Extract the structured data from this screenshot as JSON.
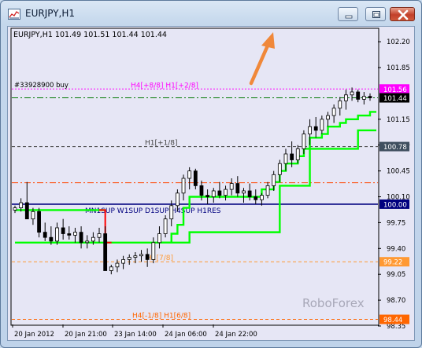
{
  "window": {
    "title": "EURJPY,H1",
    "icon": "chart-icon",
    "controls": [
      "minimize-icon",
      "maximize-icon",
      "close-icon"
    ]
  },
  "chart_info": {
    "symbol_line": "EURJPY,H1  101.49 101.51 101.44 101.44",
    "order_label": "#33928900 buy",
    "watermark": "RoboForex"
  },
  "colors": {
    "background": "#e6e6f5",
    "axis_text": "#000000",
    "candles": "#000000",
    "support_lines": "#00ff00",
    "resistance_line": "#ff0000",
    "level_line": "#00007f",
    "arrow": "#f0883a",
    "magenta": "#ff00ff",
    "orange": "#ff9933",
    "gray_dashed": "#444444",
    "dashdot_orange": "#ff6600"
  },
  "chart_data": {
    "type": "candlestick",
    "title": "EURJPY,H1",
    "y_range": [
      98.35,
      102.35
    ],
    "y_ticks": [
      "102.20",
      "101.85",
      "101.15",
      "100.80",
      "100.45",
      "100.10",
      "99.75",
      "99.40",
      "99.05",
      "98.70",
      "98.35"
    ],
    "x_ticks": [
      "20 Jan 2012",
      "20 Jan 21:00",
      "23 Jan 14:00",
      "24 Jan 06:00",
      "24 Jan 22:00"
    ],
    "price_labels": [
      {
        "text": "101.56",
        "value": 101.56,
        "bg": "#ff00ff"
      },
      {
        "text": "101.44",
        "value": 101.44,
        "bg": "#000000"
      },
      {
        "text": "100.78",
        "value": 100.78,
        "bg": "#3f4f5f"
      },
      {
        "text": "100.00",
        "value": 100.0,
        "bg": "#00007f"
      },
      {
        "text": "99.22",
        "value": 99.22,
        "bg": "#ff9933"
      },
      {
        "text": "98.44",
        "value": 98.44,
        "bg": "#ff6600"
      }
    ],
    "levels": [
      {
        "label": "H4[+8/8] H1[+2/8]",
        "value": 101.56,
        "color": "#ff00ff",
        "style": "dotted"
      },
      {
        "label": "",
        "value": 101.44,
        "color": "#007700",
        "style": "dashdot"
      },
      {
        "label": "H1[+1/8]",
        "value": 100.78,
        "color": "#444444",
        "style": "dashed"
      },
      {
        "label": "",
        "value": 100.29,
        "color": "#ff4400",
        "style": "dashdot"
      },
      {
        "label": "MN1SUP W1SUP D1SUP H4SUP H1RES",
        "value": 100.0,
        "color": "#00007f",
        "style": "solid"
      },
      {
        "label": "H1[7/8]",
        "value": 99.22,
        "color": "#ff9933",
        "style": "dashed"
      },
      {
        "label": "H4[-1/8] H1[6/8]",
        "value": 98.44,
        "color": "#ff6600",
        "style": "dashed"
      }
    ],
    "candles": [
      [
        99.92,
        99.98,
        99.88,
        99.95
      ],
      [
        99.95,
        100.08,
        99.9,
        100.02
      ],
      [
        100.02,
        100.3,
        99.85,
        99.8
      ],
      [
        99.8,
        99.95,
        99.72,
        99.9
      ],
      [
        99.9,
        99.95,
        99.55,
        99.62
      ],
      [
        99.62,
        99.75,
        99.5,
        99.55
      ],
      [
        99.55,
        99.7,
        99.45,
        99.5
      ],
      [
        99.5,
        99.75,
        99.45,
        99.68
      ],
      [
        99.68,
        99.8,
        99.52,
        99.6
      ],
      [
        99.6,
        99.7,
        99.52,
        99.58
      ],
      [
        99.58,
        99.68,
        99.48,
        99.62
      ],
      [
        99.62,
        99.7,
        99.4,
        99.48
      ],
      [
        99.48,
        99.58,
        99.4,
        99.5
      ],
      [
        99.5,
        99.62,
        99.45,
        99.55
      ],
      [
        99.55,
        99.68,
        99.48,
        99.6
      ],
      [
        99.6,
        99.7,
        99.3,
        99.1
      ],
      [
        99.1,
        99.18,
        99.05,
        99.15
      ],
      [
        99.15,
        99.25,
        99.08,
        99.2
      ],
      [
        99.2,
        99.3,
        99.12,
        99.25
      ],
      [
        99.25,
        99.32,
        99.18,
        99.28
      ],
      [
        99.28,
        99.35,
        99.2,
        99.3
      ],
      [
        99.3,
        99.38,
        99.22,
        99.32
      ],
      [
        99.32,
        99.4,
        99.15,
        99.25
      ],
      [
        99.25,
        99.55,
        99.2,
        99.48
      ],
      [
        99.48,
        99.7,
        99.4,
        99.6
      ],
      [
        99.6,
        99.85,
        99.55,
        99.8
      ],
      [
        99.8,
        100.05,
        99.7,
        99.98
      ],
      [
        99.98,
        100.2,
        99.9,
        100.15
      ],
      [
        100.15,
        100.4,
        100.05,
        100.35
      ],
      [
        100.35,
        100.5,
        100.2,
        100.45
      ],
      [
        100.45,
        100.48,
        100.2,
        100.25
      ],
      [
        100.25,
        100.32,
        100.05,
        100.12
      ],
      [
        100.12,
        100.2,
        100.0,
        100.1
      ],
      [
        100.1,
        100.22,
        100.02,
        100.18
      ],
      [
        100.18,
        100.3,
        100.08,
        100.12
      ],
      [
        100.12,
        100.25,
        100.05,
        100.2
      ],
      [
        100.2,
        100.35,
        100.12,
        100.28
      ],
      [
        100.28,
        100.38,
        100.1,
        100.15
      ],
      [
        100.15,
        100.22,
        100.02,
        100.18
      ],
      [
        100.18,
        100.28,
        100.05,
        100.1
      ],
      [
        100.1,
        100.2,
        100.0,
        100.06
      ],
      [
        100.06,
        100.15,
        99.98,
        100.12
      ],
      [
        100.12,
        100.3,
        100.08,
        100.25
      ],
      [
        100.25,
        100.45,
        100.18,
        100.4
      ],
      [
        100.4,
        100.6,
        100.3,
        100.55
      ],
      [
        100.55,
        100.75,
        100.45,
        100.68
      ],
      [
        100.68,
        100.85,
        100.5,
        100.6
      ],
      [
        100.6,
        100.8,
        100.55,
        100.75
      ],
      [
        100.75,
        101.0,
        100.68,
        100.95
      ],
      [
        100.95,
        101.15,
        100.8,
        101.05
      ],
      [
        101.05,
        101.18,
        100.9,
        101.0
      ],
      [
        101.0,
        101.2,
        100.95,
        101.15
      ],
      [
        101.15,
        101.25,
        101.05,
        101.2
      ],
      [
        101.2,
        101.35,
        101.1,
        101.3
      ],
      [
        101.3,
        101.45,
        101.2,
        101.4
      ],
      [
        101.4,
        101.55,
        101.28,
        101.48
      ],
      [
        101.48,
        101.58,
        101.4,
        101.52
      ],
      [
        101.52,
        101.55,
        101.38,
        101.42
      ],
      [
        101.42,
        101.52,
        101.35,
        101.46
      ],
      [
        101.46,
        101.5,
        101.4,
        101.44
      ]
    ],
    "support_series": [
      [
        99.48,
        99.48,
        99.48,
        99.48,
        99.48,
        99.48,
        99.48,
        99.48,
        99.48,
        99.48,
        99.48,
        99.48,
        99.48,
        99.48,
        99.48,
        99.48,
        99.48,
        99.48,
        99.48,
        99.48,
        99.48,
        99.48,
        99.48,
        99.48,
        99.48,
        99.48,
        99.48,
        99.48,
        99.48,
        99.62,
        99.62,
        99.62,
        99.62,
        99.62,
        99.62,
        99.62,
        99.62,
        99.62,
        99.62,
        99.62,
        99.62,
        99.62,
        99.62,
        99.62,
        100.25,
        100.25,
        100.25,
        100.25,
        100.25,
        100.75,
        100.75,
        100.75,
        100.75,
        100.75,
        100.75,
        100.75,
        100.75,
        101.0,
        101.0,
        101.0
      ],
      [
        99.92,
        99.92,
        99.92,
        99.92,
        99.92,
        99.92,
        99.92,
        99.92,
        99.92,
        99.92,
        99.92,
        99.92,
        99.92,
        99.92,
        99.92,
        null,
        null,
        null,
        null,
        null,
        null,
        null,
        null,
        null,
        99.48,
        99.48,
        99.6,
        99.72,
        99.95,
        100.1,
        100.1,
        100.1,
        100.1,
        100.1,
        100.1,
        100.1,
        100.1,
        100.1,
        100.1,
        100.1,
        100.1,
        100.2,
        100.2,
        100.3,
        100.45,
        100.55,
        100.55,
        100.65,
        100.75,
        100.9,
        100.9,
        100.95,
        101.05,
        101.05,
        101.1,
        101.15,
        101.15,
        101.2,
        101.2,
        101.25
      ]
    ],
    "resistance_series": [
      [
        null,
        null,
        null,
        null,
        null,
        null,
        null,
        null,
        null,
        null,
        null,
        null,
        null,
        null,
        99.92,
        99.48
      ]
    ]
  }
}
